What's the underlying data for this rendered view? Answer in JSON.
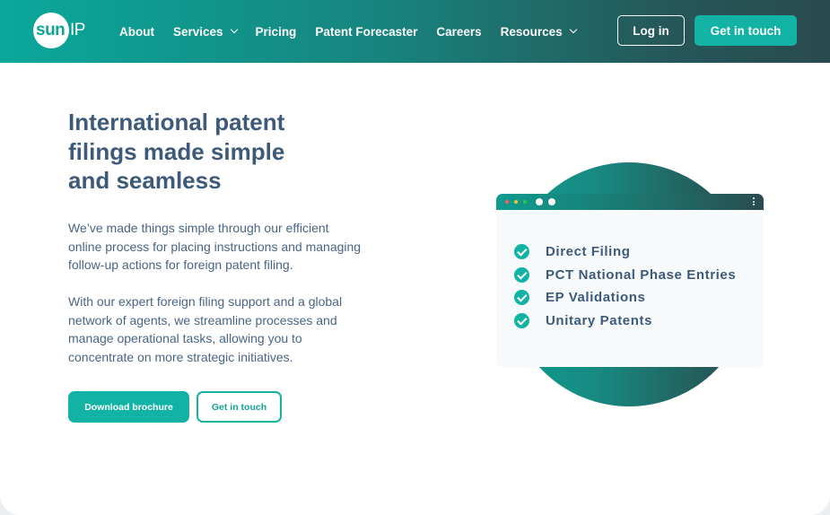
{
  "nav": {
    "logo": {
      "sun": "sun",
      "ip": "IP"
    },
    "items": [
      {
        "label": "About",
        "dropdown": false
      },
      {
        "label": "Services",
        "dropdown": true
      },
      {
        "label": "Pricing",
        "dropdown": false
      },
      {
        "label": "Patent Forecaster",
        "dropdown": false
      },
      {
        "label": "Careers",
        "dropdown": false
      },
      {
        "label": "Resources",
        "dropdown": true
      }
    ],
    "login_label": "Log in",
    "contact_label": "Get in touch"
  },
  "hero": {
    "headline": [
      "International patent",
      "filings made simple",
      "and seamless"
    ],
    "paragraph1": [
      "We’ve made things simple through our efficient",
      "online process for placing instructions and managing",
      "follow-up actions for foreign patent filing."
    ],
    "paragraph2": [
      "With our expert foreign filing support and a global",
      "network of agents, we streamline processes and",
      "manage operational tasks, allowing you to",
      "concentrate on more strategic initiatives."
    ],
    "download_label": "Download brochure",
    "touch_label": "Get in touch"
  },
  "features": {
    "items": [
      "Direct Filing",
      "PCT National Phase Entries",
      "EP Validations",
      "Unitary Patents"
    ]
  },
  "colors": {
    "accent": "#12b3a5",
    "heading": "#3d5a7a",
    "body_text": "#4a6584",
    "nav_gradient_start": "#0aa89b",
    "nav_gradient_end": "#2a4a4d"
  },
  "icons": [
    "chevron-down-icon",
    "check-circle-icon",
    "window-dots-icon",
    "kebab-menu-icon"
  ]
}
